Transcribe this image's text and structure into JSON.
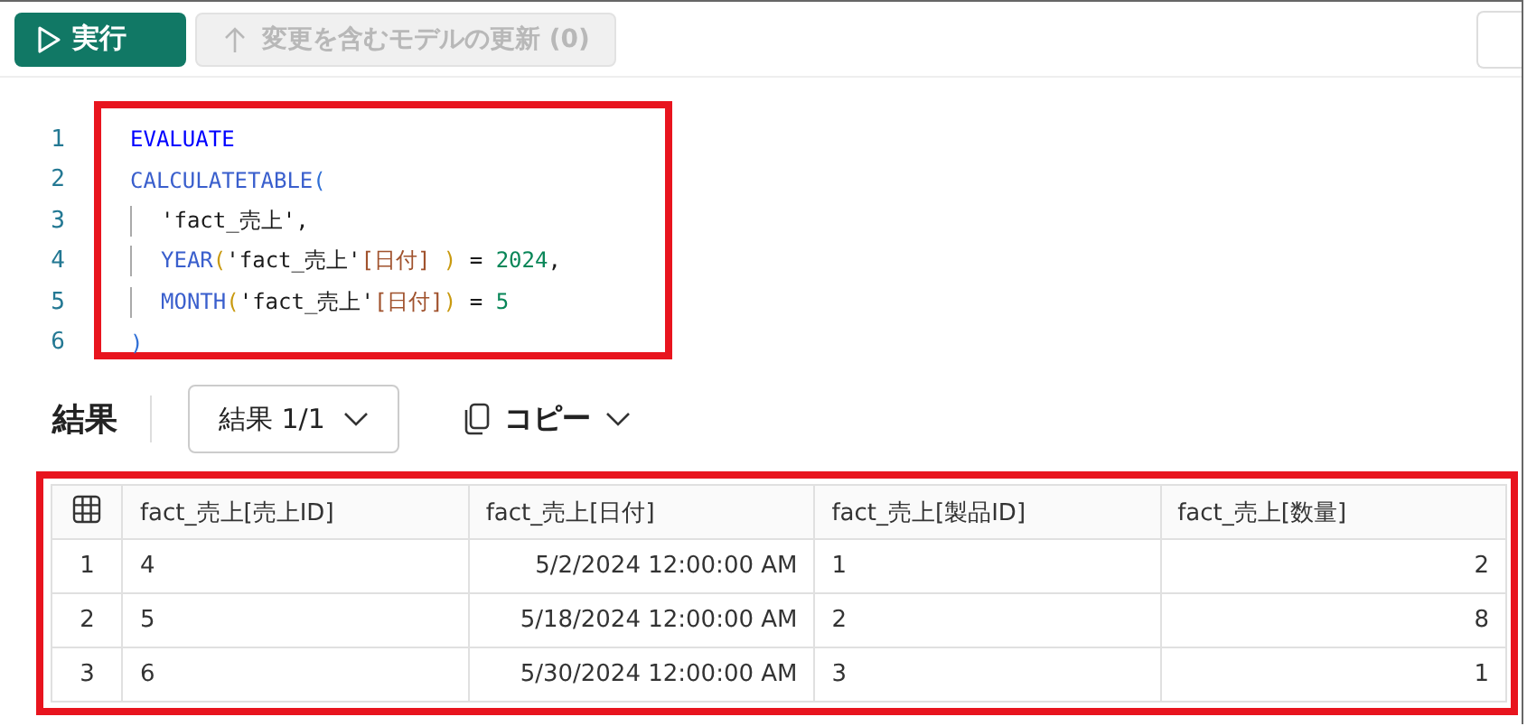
{
  "toolbar": {
    "run_button": {
      "label": "実行"
    },
    "update_button": {
      "label": "変更を含むモデルの更新 (0)",
      "disabled": true
    }
  },
  "editor": {
    "highlighted": true,
    "lines": [
      {
        "number": "1",
        "indented": false,
        "tokens": [
          {
            "kind": "keyword",
            "text": "EVALUATE"
          }
        ]
      },
      {
        "number": "2",
        "indented": false,
        "tokens": [
          {
            "kind": "function",
            "text": "CALCULATETABLE"
          },
          {
            "kind": "bracket1",
            "text": "("
          }
        ]
      },
      {
        "number": "3",
        "indented": true,
        "tokens": [
          {
            "kind": "plain",
            "text": "'fact_売上',"
          }
        ]
      },
      {
        "number": "4",
        "indented": true,
        "tokens": [
          {
            "kind": "function",
            "text": "YEAR"
          },
          {
            "kind": "bracket2",
            "text": "("
          },
          {
            "kind": "plain",
            "text": "'fact_売上'"
          },
          {
            "kind": "column",
            "text": "[日付] "
          },
          {
            "kind": "bracket2",
            "text": ")"
          },
          {
            "kind": "plain",
            "text": " = "
          },
          {
            "kind": "number",
            "text": "2024"
          },
          {
            "kind": "plain",
            "text": ","
          }
        ]
      },
      {
        "number": "5",
        "indented": true,
        "tokens": [
          {
            "kind": "function",
            "text": "MONTH"
          },
          {
            "kind": "bracket2",
            "text": "("
          },
          {
            "kind": "plain",
            "text": "'fact_売上'"
          },
          {
            "kind": "column",
            "text": "[日付]"
          },
          {
            "kind": "bracket2",
            "text": ")"
          },
          {
            "kind": "plain",
            "text": " = "
          },
          {
            "kind": "number",
            "text": "5"
          }
        ]
      },
      {
        "number": "6",
        "indented": false,
        "tokens": [
          {
            "kind": "bracket1",
            "text": ")"
          }
        ]
      }
    ]
  },
  "results": {
    "title": "結果",
    "result_dropdown": "結果 1/1",
    "copy_button": "コピー",
    "highlighted": true,
    "table": {
      "columns": [
        {
          "label": "fact_売上[売上ID]",
          "right_aligned": false
        },
        {
          "label": "fact_売上[日付]",
          "right_aligned": true
        },
        {
          "label": "fact_売上[製品ID]",
          "right_aligned": false
        },
        {
          "label": "fact_売上[数量]",
          "right_aligned": true
        }
      ],
      "rows": [
        {
          "number": "1",
          "cells": [
            "4",
            "5/2/2024 12:00:00 AM",
            "1",
            "2"
          ]
        },
        {
          "number": "2",
          "cells": [
            "5",
            "5/18/2024 12:00:00 AM",
            "2",
            "8"
          ]
        },
        {
          "number": "3",
          "cells": [
            "6",
            "5/30/2024 12:00:00 AM",
            "3",
            "1"
          ]
        }
      ]
    }
  }
}
